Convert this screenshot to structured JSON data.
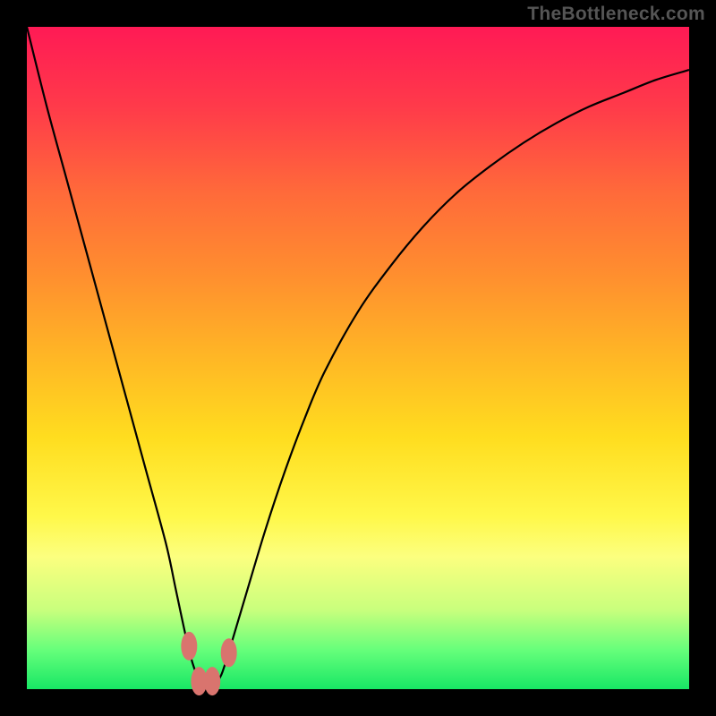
{
  "watermark": "TheBottleneck.com",
  "colors": {
    "background": "#000000",
    "gradient_top": "#ff1a55",
    "gradient_bottom": "#18e765",
    "curve": "#000000",
    "marker": "#d9746e"
  },
  "chart_data": {
    "type": "line",
    "title": "",
    "xlabel": "",
    "ylabel": "",
    "xlim": [
      0,
      100
    ],
    "ylim": [
      0,
      100
    ],
    "x": [
      0,
      3,
      6,
      9,
      12,
      15,
      18,
      21,
      22.5,
      24,
      25,
      26,
      27,
      28,
      29,
      30,
      33,
      36,
      39,
      42,
      45,
      50,
      55,
      60,
      65,
      70,
      75,
      80,
      85,
      90,
      95,
      100
    ],
    "y": [
      100,
      88,
      77,
      66,
      55,
      44,
      33,
      22,
      15,
      8,
      4,
      1.5,
      0.5,
      0.5,
      1.5,
      4,
      14,
      24,
      33,
      41,
      48,
      57,
      64,
      70,
      75,
      79,
      82.5,
      85.5,
      88,
      90,
      92,
      93.5
    ],
    "markers": [
      {
        "x": 24.5,
        "y": 6.5,
        "label": "left-marker"
      },
      {
        "x": 26.0,
        "y": 1.2,
        "label": "bottom-left-marker"
      },
      {
        "x": 28.0,
        "y": 1.2,
        "label": "bottom-right-marker"
      },
      {
        "x": 30.5,
        "y": 5.5,
        "label": "right-marker"
      }
    ]
  }
}
